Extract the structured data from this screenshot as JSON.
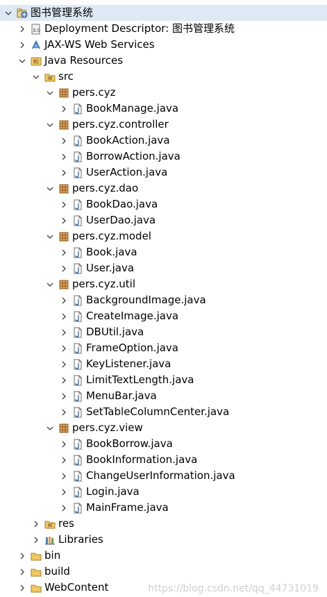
{
  "tree": [
    {
      "label": "图书管理系统",
      "icon": "project-icon",
      "level": 0,
      "expanded": true,
      "selected": true
    },
    {
      "label": "Deployment Descriptor: 图书管理系统",
      "icon": "deployment-descriptor-icon",
      "level": 1,
      "expanded": false
    },
    {
      "label": "JAX-WS Web Services",
      "icon": "web-services-icon",
      "level": 1,
      "expanded": false
    },
    {
      "label": "Java Resources",
      "icon": "java-resources-icon",
      "level": 1,
      "expanded": true
    },
    {
      "label": "src",
      "icon": "source-folder-icon",
      "level": 2,
      "expanded": true
    },
    {
      "label": "pers.cyz",
      "icon": "package-icon",
      "level": 3,
      "expanded": true
    },
    {
      "label": "BookManage.java",
      "icon": "java-file-icon",
      "level": 4,
      "expanded": false
    },
    {
      "label": "pers.cyz.controller",
      "icon": "package-icon",
      "level": 3,
      "expanded": true
    },
    {
      "label": "BookAction.java",
      "icon": "java-file-icon",
      "level": 4,
      "expanded": false
    },
    {
      "label": "BorrowAction.java",
      "icon": "java-file-icon",
      "level": 4,
      "expanded": false
    },
    {
      "label": "UserAction.java",
      "icon": "java-file-icon",
      "level": 4,
      "expanded": false
    },
    {
      "label": "pers.cyz.dao",
      "icon": "package-icon",
      "level": 3,
      "expanded": true
    },
    {
      "label": "BookDao.java",
      "icon": "java-file-icon",
      "level": 4,
      "expanded": false
    },
    {
      "label": "UserDao.java",
      "icon": "java-file-icon",
      "level": 4,
      "expanded": false
    },
    {
      "label": "pers.cyz.model",
      "icon": "package-icon",
      "level": 3,
      "expanded": true
    },
    {
      "label": "Book.java",
      "icon": "java-file-icon",
      "level": 4,
      "expanded": false
    },
    {
      "label": "User.java",
      "icon": "java-file-icon",
      "level": 4,
      "expanded": false
    },
    {
      "label": "pers.cyz.util",
      "icon": "package-icon",
      "level": 3,
      "expanded": true
    },
    {
      "label": "BackgroundImage.java",
      "icon": "java-file-icon",
      "level": 4,
      "expanded": false
    },
    {
      "label": "CreateImage.java",
      "icon": "java-file-icon",
      "level": 4,
      "expanded": false
    },
    {
      "label": "DBUtil.java",
      "icon": "java-file-icon",
      "level": 4,
      "expanded": false
    },
    {
      "label": "FrameOption.java",
      "icon": "java-file-icon",
      "level": 4,
      "expanded": false
    },
    {
      "label": "KeyListener.java",
      "icon": "java-file-icon",
      "level": 4,
      "expanded": false
    },
    {
      "label": "LimitTextLength.java",
      "icon": "java-file-icon",
      "level": 4,
      "expanded": false
    },
    {
      "label": "MenuBar.java",
      "icon": "java-file-icon",
      "level": 4,
      "expanded": false
    },
    {
      "label": "SetTableColumnCenter.java",
      "icon": "java-file-icon",
      "level": 4,
      "expanded": false
    },
    {
      "label": "pers.cyz.view",
      "icon": "package-icon",
      "level": 3,
      "expanded": true
    },
    {
      "label": "BookBorrow.java",
      "icon": "java-file-icon",
      "level": 4,
      "expanded": false
    },
    {
      "label": "BookInformation.java",
      "icon": "java-file-icon",
      "level": 4,
      "expanded": false
    },
    {
      "label": "ChangeUserInformation.java",
      "icon": "java-file-icon",
      "level": 4,
      "expanded": false
    },
    {
      "label": "Login.java",
      "icon": "java-file-icon",
      "level": 4,
      "expanded": false
    },
    {
      "label": "MainFrame.java",
      "icon": "java-file-icon",
      "level": 4,
      "expanded": false
    },
    {
      "label": "res",
      "icon": "source-folder-icon",
      "level": 2,
      "expanded": false
    },
    {
      "label": "Libraries",
      "icon": "libraries-icon",
      "level": 2,
      "expanded": false
    },
    {
      "label": "bin",
      "icon": "folder-icon",
      "level": 1,
      "expanded": false
    },
    {
      "label": "build",
      "icon": "folder-icon",
      "level": 1,
      "expanded": false
    },
    {
      "label": "WebContent",
      "icon": "folder-icon",
      "level": 1,
      "expanded": false
    }
  ],
  "watermark": "https://blog.csdn.net/qq_44731019"
}
